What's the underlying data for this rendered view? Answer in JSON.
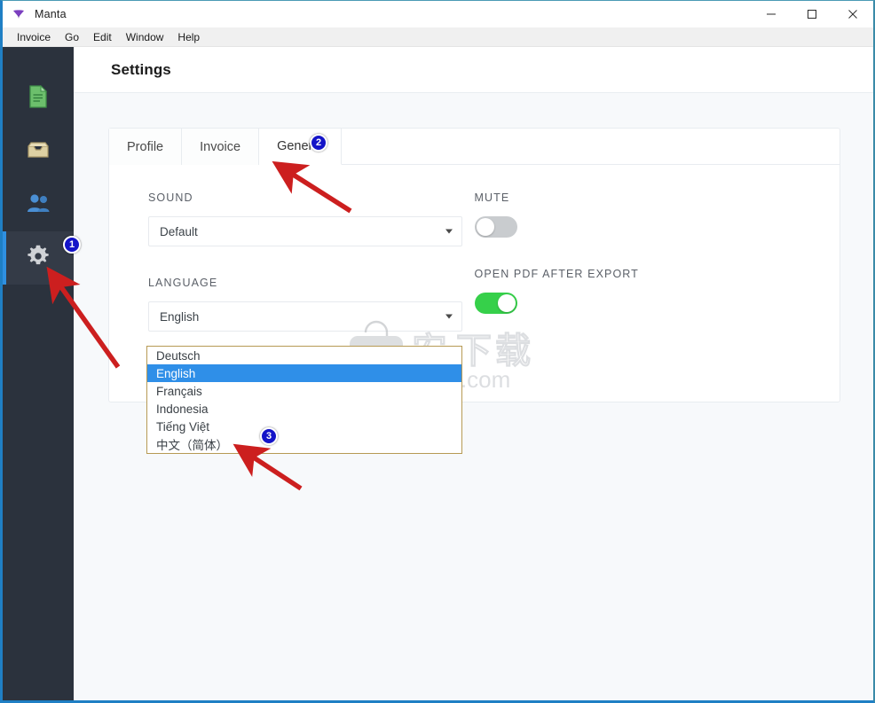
{
  "window": {
    "app_title": "Manta",
    "app_icon": "manta-logo-icon",
    "controls": {
      "minimize": "minimize-icon",
      "maximize": "maximize-icon",
      "close": "close-icon"
    }
  },
  "menubar": {
    "items": [
      {
        "label": "Invoice"
      },
      {
        "label": "Go"
      },
      {
        "label": "Edit"
      },
      {
        "label": "Window"
      },
      {
        "label": "Help"
      }
    ]
  },
  "sidebar": {
    "items": [
      {
        "name": "documents",
        "icon": "document-icon",
        "active": false
      },
      {
        "name": "inbox",
        "icon": "inbox-tray-icon",
        "active": false
      },
      {
        "name": "contacts",
        "icon": "people-icon",
        "active": false
      },
      {
        "name": "settings",
        "icon": "gear-icon",
        "active": true
      }
    ]
  },
  "header": {
    "title": "Settings"
  },
  "tabs": [
    {
      "label": "Profile",
      "active": false
    },
    {
      "label": "Invoice",
      "active": false
    },
    {
      "label": "General",
      "active": true
    }
  ],
  "settings": {
    "sound": {
      "label": "SOUND",
      "value": "Default"
    },
    "mute": {
      "label": "MUTE",
      "state": "off"
    },
    "language": {
      "label": "LANGUAGE",
      "value": "English",
      "options": [
        {
          "label": "Deutsch",
          "selected": false
        },
        {
          "label": "English",
          "selected": true
        },
        {
          "label": "Français",
          "selected": false
        },
        {
          "label": "Indonesia",
          "selected": false
        },
        {
          "label": "Tiếng Việt",
          "selected": false
        },
        {
          "label": "中文（简体）",
          "selected": false
        }
      ]
    },
    "open_pdf": {
      "label": "OPEN PDF AFTER EXPORT",
      "state": "on"
    }
  },
  "annotations": {
    "badges": [
      {
        "number": "1"
      },
      {
        "number": "2"
      },
      {
        "number": "3"
      }
    ],
    "arrow_color": "#cc1f1f",
    "badge_color": "#1414c8"
  },
  "watermark": {
    "text_cn": "安下载",
    "text_domain": "anxz.com",
    "shield_char": "安"
  },
  "colors": {
    "sidebar_bg": "#2b323d",
    "sidebar_active_bar": "#2f90e0",
    "toggle_on": "#36d04a",
    "toggle_off": "#c9cccf",
    "option_selected": "#2f8fe8",
    "dropdown_border": "#b79a54",
    "window_border": "#1f7fc4"
  }
}
